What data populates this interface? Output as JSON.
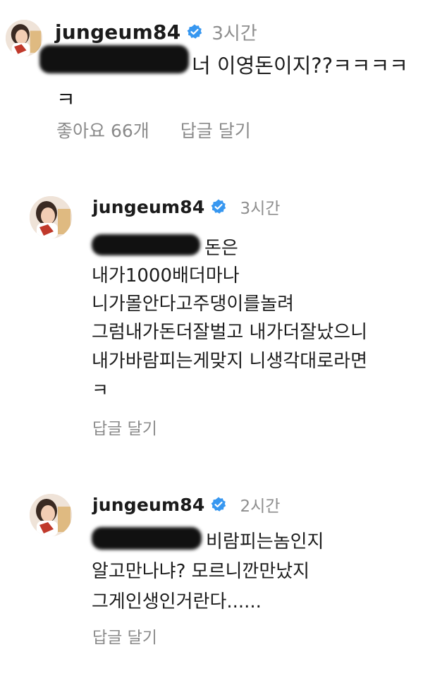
{
  "comments": [
    {
      "username": "jungeum84",
      "time": "3시간",
      "lines": [
        "너 이영돈이지??ㅋㅋㅋㅋ",
        "ㅋ"
      ],
      "likes_label": "좋아요 66개",
      "reply_label": "답글 달기"
    },
    {
      "username": "jungeum84",
      "time": "3시간",
      "lines": [
        "돈은",
        "내가1000배더마나",
        "니가몰안다고주댕이를놀려",
        "그럼내가돈더잘벌고 내가더잘났으니",
        "내가바람피는게맞지 니생각대로라면",
        "ㅋ"
      ],
      "reply_label": "답글 달기"
    },
    {
      "username": "jungeum84",
      "time": "2시간",
      "lines": [
        "비람피는놈인지",
        "알고만나냐? 모르니깐만났지",
        "그게인생인거란다......"
      ],
      "reply_label": "답글 달기"
    }
  ],
  "icons": {
    "verified": "verified-badge-icon",
    "avatar": "profile-avatar"
  },
  "colors": {
    "verified_blue": "#3797f0",
    "muted_text": "#8e8e8e",
    "redaction": "#111111"
  }
}
